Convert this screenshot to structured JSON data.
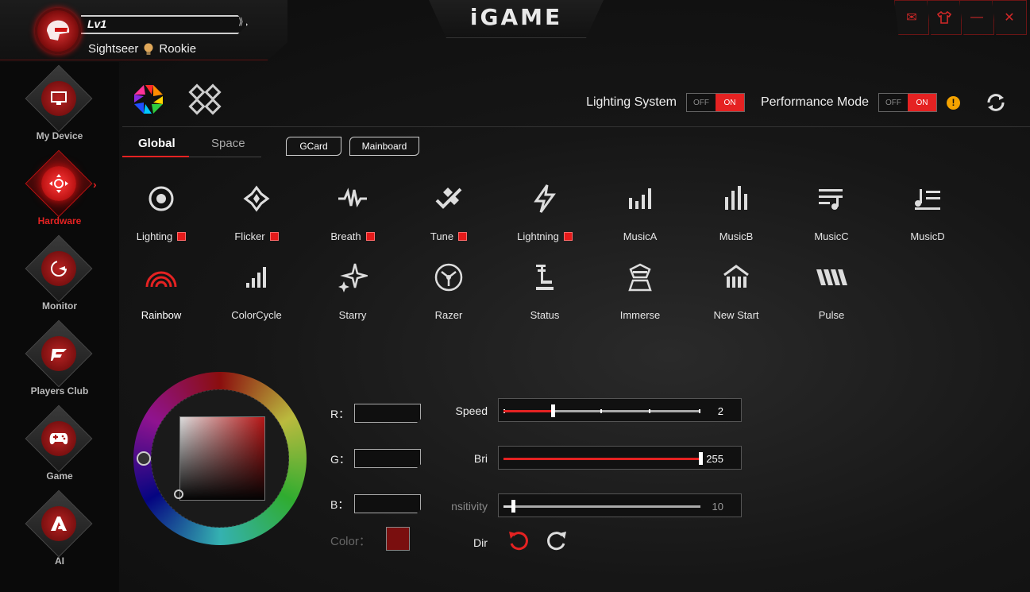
{
  "profile": {
    "level": "Lv1",
    "title": "Sightseer",
    "rank": "Rookie"
  },
  "app": {
    "logo": "iGAME"
  },
  "window_controls": [
    {
      "name": "mail-icon",
      "glyph": "✉"
    },
    {
      "name": "skin-icon",
      "glyph": "👕"
    },
    {
      "name": "minimize-icon",
      "glyph": "—"
    },
    {
      "name": "close-icon",
      "glyph": "✕"
    }
  ],
  "sidebar": {
    "items": [
      {
        "label": "My Device",
        "icon": "monitor-icon"
      },
      {
        "label": "Hardware",
        "icon": "dpad-icon",
        "active": true
      },
      {
        "label": "Monitor",
        "icon": "speedometer-icon"
      },
      {
        "label": "Players Club",
        "icon": "club-icon"
      },
      {
        "label": "Game",
        "icon": "gamepad-icon"
      },
      {
        "label": "AI",
        "icon": "ai-icon"
      }
    ]
  },
  "header": {
    "lighting_system_label": "Lighting System",
    "performance_mode_label": "Performance Mode",
    "off": "OFF",
    "on": "ON",
    "warning": "!"
  },
  "tabs": {
    "global": "Global",
    "space": "Space"
  },
  "devices": {
    "gcard": "GCard",
    "mainboard": "Mainboard"
  },
  "effects": [
    {
      "label": "Lighting",
      "marked": true,
      "icon": "target-icon"
    },
    {
      "label": "Flicker",
      "marked": true,
      "icon": "flicker-icon"
    },
    {
      "label": "Breath",
      "marked": true,
      "icon": "pulse-wave-icon"
    },
    {
      "label": "Tune",
      "marked": true,
      "icon": "tune-icon"
    },
    {
      "label": "Lightning",
      "marked": true,
      "icon": "bolt-icon"
    },
    {
      "label": "MusicA",
      "marked": false,
      "icon": "bars-a-icon"
    },
    {
      "label": "MusicB",
      "marked": false,
      "icon": "bars-b-icon"
    },
    {
      "label": "MusicC",
      "marked": false,
      "icon": "music-list-icon"
    },
    {
      "label": "MusicD",
      "marked": false,
      "icon": "music-note-icon"
    },
    {
      "label": "Rainbow",
      "marked": false,
      "icon": "rainbow-icon"
    },
    {
      "label": "ColorCycle",
      "marked": false,
      "icon": "signal-icon"
    },
    {
      "label": "Starry",
      "marked": false,
      "icon": "star-icon"
    },
    {
      "label": "Razer",
      "marked": false,
      "icon": "razer-icon"
    },
    {
      "label": "Status",
      "marked": false,
      "icon": "status-icon"
    },
    {
      "label": "Immerse",
      "marked": false,
      "icon": "immerse-icon"
    },
    {
      "label": "New Start",
      "marked": false,
      "icon": "temple-icon"
    },
    {
      "label": "Pulse",
      "marked": false,
      "icon": "pulse-icon"
    }
  ],
  "color": {
    "r_label": "R：",
    "g_label": "G：",
    "b_label": "B：",
    "r": "",
    "g": "",
    "b": "",
    "color_label": "Color：",
    "swatch": "#7a0f0f"
  },
  "sliders": {
    "speed": {
      "label": "Speed",
      "value": "2",
      "fraction": 0.25
    },
    "bri": {
      "label": "Bri",
      "value": "255",
      "fraction": 1.0
    },
    "sensitivity": {
      "label": "nsitivity",
      "value": "10",
      "fraction": 0.05
    }
  },
  "dir": {
    "label": "Dir"
  },
  "colors": {
    "accent": "#e52222",
    "warning": "#f5a300"
  }
}
